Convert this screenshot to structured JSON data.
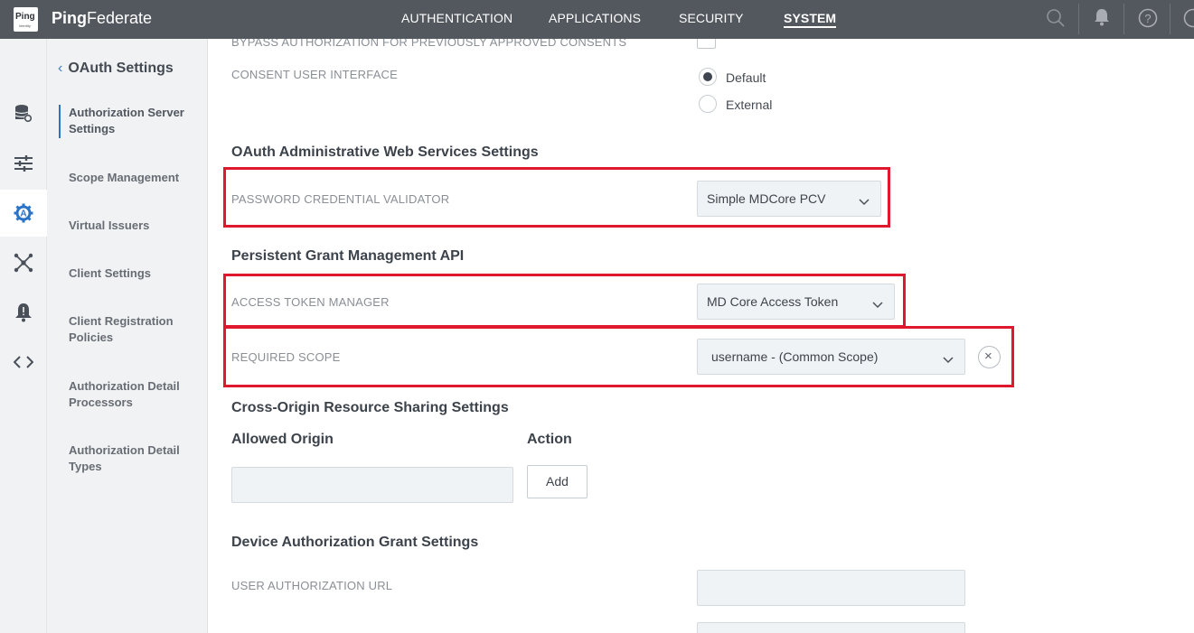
{
  "header": {
    "logo_text": "Ping",
    "logo_sub": "Identity",
    "brand_bold": "Ping",
    "brand_rest": "Federate",
    "nav": [
      "AUTHENTICATION",
      "APPLICATIONS",
      "SECURITY",
      "SYSTEM"
    ],
    "active_nav": "SYSTEM",
    "icons": [
      "search-icon",
      "bell-icon",
      "help-icon",
      "user-icon"
    ],
    "help_glyph": "?"
  },
  "iconbar": {
    "icons": [
      "database-settings-icon",
      "sliders-icon",
      "oauth-gear-icon",
      "network-icon",
      "alert-bell-icon",
      "code-icon"
    ],
    "active_index": 2
  },
  "subnav": {
    "back_glyph": "‹",
    "title": "OAuth Settings",
    "items": [
      {
        "label": "Authorization Server Settings",
        "active": true
      },
      {
        "label": "Scope Management"
      },
      {
        "label": "Virtual Issuers"
      },
      {
        "label": "Client Settings"
      },
      {
        "label": "Client Registration Policies"
      },
      {
        "label": "Authorization Detail Processors"
      },
      {
        "label": "Authorization Detail Types"
      }
    ]
  },
  "main": {
    "bypass_label": "BYPASS AUTHORIZATION FOR PREVIOUSLY APPROVED CONSENTS",
    "consent_label": "CONSENT USER INTERFACE",
    "consent_options": [
      "Default",
      "External"
    ],
    "consent_selected": "Default",
    "oauth_admin_title": "OAuth Administrative Web Services Settings",
    "pcv_label": "PASSWORD CREDENTIAL VALIDATOR",
    "pcv_value": "Simple MDCore PCV",
    "grant_title": "Persistent Grant Management API",
    "atm_label": "ACCESS TOKEN MANAGER",
    "atm_value": "MD Core Access Token",
    "scope_label": "REQUIRED SCOPE",
    "scope_value": "username - (Common Scope)",
    "clear_glyph": "×",
    "cors_title": "Cross-Origin Resource Sharing Settings",
    "allowed_origin_header": "Allowed Origin",
    "action_header": "Action",
    "allowed_origin_value": "",
    "add_button": "Add",
    "device_title": "Device Authorization Grant Settings",
    "user_auth_url_label": "USER AUTHORIZATION URL",
    "user_auth_url_value": "",
    "highlight_color": "#e0182d"
  }
}
